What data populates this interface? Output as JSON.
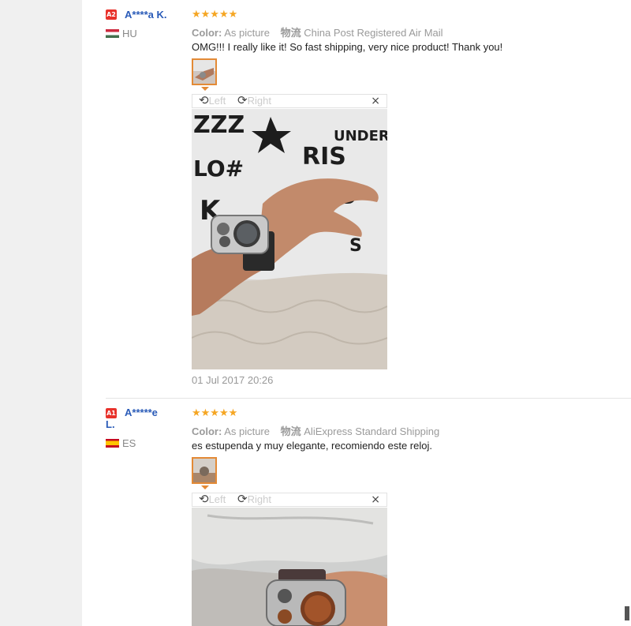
{
  "reviews": [
    {
      "badge": "A2",
      "user": "A****a K.",
      "country": "HU",
      "stars": "★★★★★",
      "color_label": "Color:",
      "color_value": "As picture",
      "shipping_label": "物流",
      "shipping_value": "China Post Registered Air Mail",
      "comment": "OMG!!! I really like it! So fast shipping, very nice product! Thank you!",
      "rotate_left": "Left",
      "rotate_right": "Right",
      "close": "×",
      "date": "01 Jul 2017 20:26"
    },
    {
      "badge": "A1",
      "user_line1": "A*****e",
      "user_line2": "L.",
      "country": "ES",
      "stars": "★★★★★",
      "color_label": "Color:",
      "color_value": "As picture",
      "shipping_label": "物流",
      "shipping_value": "AliExpress Standard Shipping",
      "comment": "es estupenda y muy elegante, recomiendo este reloj.",
      "rotate_left": "Left",
      "rotate_right": "Right",
      "close": "×"
    }
  ],
  "colors": {
    "star": "#f5a623",
    "username": "#2a5bb8",
    "badge": "#e8322b",
    "thumb_border": "#e38a36"
  }
}
